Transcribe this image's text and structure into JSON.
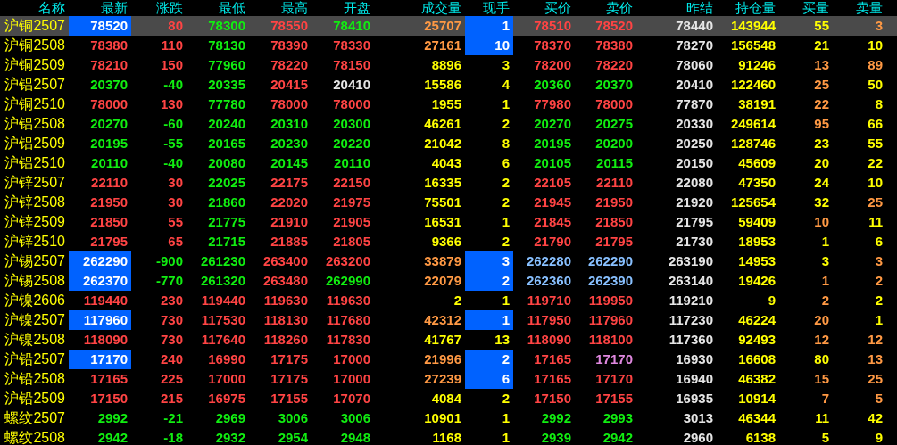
{
  "table": {
    "name_column": "名称",
    "columns": [
      "最新",
      "涨跌",
      "最低",
      "最高",
      "开盘",
      "成交量",
      "现手",
      "买价",
      "卖价",
      "昨结",
      "持仓量",
      "买量",
      "卖量"
    ],
    "rows": [
      {
        "name": "沪铜2507",
        "selected": true,
        "cells": [
          {
            "text": "78520",
            "color": "#ffffff",
            "highlighted": true
          },
          {
            "text": "80",
            "color": "#ff4444",
            "highlighted": false
          },
          {
            "text": "78300",
            "color": "#11ee11",
            "highlighted": false
          },
          {
            "text": "78550",
            "color": "#ff4444",
            "highlighted": false
          },
          {
            "text": "78410",
            "color": "#11ee11",
            "highlighted": false
          },
          {
            "text": "25707",
            "color": "#ff9944",
            "highlighted": false
          },
          {
            "text": "1",
            "color": "#ffffff",
            "highlighted": true
          },
          {
            "text": "78510",
            "color": "#ff4444",
            "highlighted": false
          },
          {
            "text": "78520",
            "color": "#ff4444",
            "highlighted": false
          },
          {
            "text": "78440",
            "color": "#e6e6e6",
            "highlighted": false
          },
          {
            "text": "143944",
            "color": "#ffff00",
            "highlighted": false
          },
          {
            "text": "55",
            "color": "#ffff00",
            "highlighted": false
          },
          {
            "text": "3",
            "color": "#ff9944",
            "highlighted": false
          }
        ]
      },
      {
        "name": "沪铜2508",
        "selected": false,
        "cells": [
          {
            "text": "78380",
            "color": "#ff4444",
            "highlighted": false
          },
          {
            "text": "110",
            "color": "#ff4444",
            "highlighted": false
          },
          {
            "text": "78130",
            "color": "#11ee11",
            "highlighted": false
          },
          {
            "text": "78390",
            "color": "#ff4444",
            "highlighted": false
          },
          {
            "text": "78330",
            "color": "#ff4444",
            "highlighted": false
          },
          {
            "text": "27161",
            "color": "#ff9944",
            "highlighted": false
          },
          {
            "text": "10",
            "color": "#ffffff",
            "highlighted": true
          },
          {
            "text": "78370",
            "color": "#ff4444",
            "highlighted": false
          },
          {
            "text": "78380",
            "color": "#ff4444",
            "highlighted": false
          },
          {
            "text": "78270",
            "color": "#e6e6e6",
            "highlighted": false
          },
          {
            "text": "156548",
            "color": "#ffff00",
            "highlighted": false
          },
          {
            "text": "21",
            "color": "#ffff00",
            "highlighted": false
          },
          {
            "text": "10",
            "color": "#ffff00",
            "highlighted": false
          }
        ]
      },
      {
        "name": "沪铜2509",
        "selected": false,
        "cells": [
          {
            "text": "78210",
            "color": "#ff4444",
            "highlighted": false
          },
          {
            "text": "150",
            "color": "#ff4444",
            "highlighted": false
          },
          {
            "text": "77960",
            "color": "#11ee11",
            "highlighted": false
          },
          {
            "text": "78220",
            "color": "#ff4444",
            "highlighted": false
          },
          {
            "text": "78150",
            "color": "#ff4444",
            "highlighted": false
          },
          {
            "text": "8896",
            "color": "#ffff00",
            "highlighted": false
          },
          {
            "text": "3",
            "color": "#ffff00",
            "highlighted": false
          },
          {
            "text": "78200",
            "color": "#ff4444",
            "highlighted": false
          },
          {
            "text": "78220",
            "color": "#ff4444",
            "highlighted": false
          },
          {
            "text": "78060",
            "color": "#e6e6e6",
            "highlighted": false
          },
          {
            "text": "91246",
            "color": "#ffff00",
            "highlighted": false
          },
          {
            "text": "13",
            "color": "#ff9944",
            "highlighted": false
          },
          {
            "text": "89",
            "color": "#ff9944",
            "highlighted": false
          }
        ]
      },
      {
        "name": "沪铝2507",
        "selected": false,
        "cells": [
          {
            "text": "20370",
            "color": "#11ee11",
            "highlighted": false
          },
          {
            "text": "-40",
            "color": "#11ee11",
            "highlighted": false
          },
          {
            "text": "20335",
            "color": "#11ee11",
            "highlighted": false
          },
          {
            "text": "20415",
            "color": "#ff4444",
            "highlighted": false
          },
          {
            "text": "20410",
            "color": "#e6e6e6",
            "highlighted": false
          },
          {
            "text": "15586",
            "color": "#ffff00",
            "highlighted": false
          },
          {
            "text": "4",
            "color": "#ffff00",
            "highlighted": false
          },
          {
            "text": "20360",
            "color": "#11ee11",
            "highlighted": false
          },
          {
            "text": "20370",
            "color": "#11ee11",
            "highlighted": false
          },
          {
            "text": "20410",
            "color": "#e6e6e6",
            "highlighted": false
          },
          {
            "text": "122460",
            "color": "#ffff00",
            "highlighted": false
          },
          {
            "text": "25",
            "color": "#ff9944",
            "highlighted": false
          },
          {
            "text": "50",
            "color": "#ffff00",
            "highlighted": false
          }
        ]
      },
      {
        "name": "沪铜2510",
        "selected": false,
        "cells": [
          {
            "text": "78000",
            "color": "#ff4444",
            "highlighted": false
          },
          {
            "text": "130",
            "color": "#ff4444",
            "highlighted": false
          },
          {
            "text": "77780",
            "color": "#11ee11",
            "highlighted": false
          },
          {
            "text": "78000",
            "color": "#ff4444",
            "highlighted": false
          },
          {
            "text": "78000",
            "color": "#ff4444",
            "highlighted": false
          },
          {
            "text": "1955",
            "color": "#ffff00",
            "highlighted": false
          },
          {
            "text": "1",
            "color": "#ffff00",
            "highlighted": false
          },
          {
            "text": "77980",
            "color": "#ff4444",
            "highlighted": false
          },
          {
            "text": "78000",
            "color": "#ff4444",
            "highlighted": false
          },
          {
            "text": "77870",
            "color": "#e6e6e6",
            "highlighted": false
          },
          {
            "text": "38191",
            "color": "#ffff00",
            "highlighted": false
          },
          {
            "text": "22",
            "color": "#ff9944",
            "highlighted": false
          },
          {
            "text": "8",
            "color": "#ffff00",
            "highlighted": false
          }
        ]
      },
      {
        "name": "沪铝2508",
        "selected": false,
        "cells": [
          {
            "text": "20270",
            "color": "#11ee11",
            "highlighted": false
          },
          {
            "text": "-60",
            "color": "#11ee11",
            "highlighted": false
          },
          {
            "text": "20240",
            "color": "#11ee11",
            "highlighted": false
          },
          {
            "text": "20310",
            "color": "#11ee11",
            "highlighted": false
          },
          {
            "text": "20300",
            "color": "#11ee11",
            "highlighted": false
          },
          {
            "text": "46261",
            "color": "#ffff00",
            "highlighted": false
          },
          {
            "text": "2",
            "color": "#ffff00",
            "highlighted": false
          },
          {
            "text": "20270",
            "color": "#11ee11",
            "highlighted": false
          },
          {
            "text": "20275",
            "color": "#11ee11",
            "highlighted": false
          },
          {
            "text": "20330",
            "color": "#e6e6e6",
            "highlighted": false
          },
          {
            "text": "249614",
            "color": "#ffff00",
            "highlighted": false
          },
          {
            "text": "95",
            "color": "#ff9944",
            "highlighted": false
          },
          {
            "text": "66",
            "color": "#ffff00",
            "highlighted": false
          }
        ]
      },
      {
        "name": "沪铝2509",
        "selected": false,
        "cells": [
          {
            "text": "20195",
            "color": "#11ee11",
            "highlighted": false
          },
          {
            "text": "-55",
            "color": "#11ee11",
            "highlighted": false
          },
          {
            "text": "20165",
            "color": "#11ee11",
            "highlighted": false
          },
          {
            "text": "20230",
            "color": "#11ee11",
            "highlighted": false
          },
          {
            "text": "20220",
            "color": "#11ee11",
            "highlighted": false
          },
          {
            "text": "21042",
            "color": "#ffff00",
            "highlighted": false
          },
          {
            "text": "8",
            "color": "#ffff00",
            "highlighted": false
          },
          {
            "text": "20195",
            "color": "#11ee11",
            "highlighted": false
          },
          {
            "text": "20200",
            "color": "#11ee11",
            "highlighted": false
          },
          {
            "text": "20250",
            "color": "#e6e6e6",
            "highlighted": false
          },
          {
            "text": "128746",
            "color": "#ffff00",
            "highlighted": false
          },
          {
            "text": "23",
            "color": "#ffff00",
            "highlighted": false
          },
          {
            "text": "55",
            "color": "#ffff00",
            "highlighted": false
          }
        ]
      },
      {
        "name": "沪铝2510",
        "selected": false,
        "cells": [
          {
            "text": "20110",
            "color": "#11ee11",
            "highlighted": false
          },
          {
            "text": "-40",
            "color": "#11ee11",
            "highlighted": false
          },
          {
            "text": "20080",
            "color": "#11ee11",
            "highlighted": false
          },
          {
            "text": "20145",
            "color": "#11ee11",
            "highlighted": false
          },
          {
            "text": "20110",
            "color": "#11ee11",
            "highlighted": false
          },
          {
            "text": "4043",
            "color": "#ffff00",
            "highlighted": false
          },
          {
            "text": "6",
            "color": "#ffff00",
            "highlighted": false
          },
          {
            "text": "20105",
            "color": "#11ee11",
            "highlighted": false
          },
          {
            "text": "20115",
            "color": "#11ee11",
            "highlighted": false
          },
          {
            "text": "20150",
            "color": "#e6e6e6",
            "highlighted": false
          },
          {
            "text": "45609",
            "color": "#ffff00",
            "highlighted": false
          },
          {
            "text": "20",
            "color": "#ffff00",
            "highlighted": false
          },
          {
            "text": "22",
            "color": "#ffff00",
            "highlighted": false
          }
        ]
      },
      {
        "name": "沪锌2507",
        "selected": false,
        "cells": [
          {
            "text": "22110",
            "color": "#ff4444",
            "highlighted": false
          },
          {
            "text": "30",
            "color": "#ff4444",
            "highlighted": false
          },
          {
            "text": "22025",
            "color": "#11ee11",
            "highlighted": false
          },
          {
            "text": "22175",
            "color": "#ff4444",
            "highlighted": false
          },
          {
            "text": "22150",
            "color": "#ff4444",
            "highlighted": false
          },
          {
            "text": "16335",
            "color": "#ffff00",
            "highlighted": false
          },
          {
            "text": "2",
            "color": "#ffff00",
            "highlighted": false
          },
          {
            "text": "22105",
            "color": "#ff4444",
            "highlighted": false
          },
          {
            "text": "22110",
            "color": "#ff4444",
            "highlighted": false
          },
          {
            "text": "22080",
            "color": "#e6e6e6",
            "highlighted": false
          },
          {
            "text": "47350",
            "color": "#ffff00",
            "highlighted": false
          },
          {
            "text": "24",
            "color": "#ffff00",
            "highlighted": false
          },
          {
            "text": "10",
            "color": "#ffff00",
            "highlighted": false
          }
        ]
      },
      {
        "name": "沪锌2508",
        "selected": false,
        "cells": [
          {
            "text": "21950",
            "color": "#ff4444",
            "highlighted": false
          },
          {
            "text": "30",
            "color": "#ff4444",
            "highlighted": false
          },
          {
            "text": "21860",
            "color": "#11ee11",
            "highlighted": false
          },
          {
            "text": "22020",
            "color": "#ff4444",
            "highlighted": false
          },
          {
            "text": "21975",
            "color": "#ff4444",
            "highlighted": false
          },
          {
            "text": "75501",
            "color": "#ffff00",
            "highlighted": false
          },
          {
            "text": "2",
            "color": "#ffff00",
            "highlighted": false
          },
          {
            "text": "21945",
            "color": "#ff4444",
            "highlighted": false
          },
          {
            "text": "21950",
            "color": "#ff4444",
            "highlighted": false
          },
          {
            "text": "21920",
            "color": "#e6e6e6",
            "highlighted": false
          },
          {
            "text": "125654",
            "color": "#ffff00",
            "highlighted": false
          },
          {
            "text": "32",
            "color": "#ffff00",
            "highlighted": false
          },
          {
            "text": "25",
            "color": "#ff9944",
            "highlighted": false
          }
        ]
      },
      {
        "name": "沪锌2509",
        "selected": false,
        "cells": [
          {
            "text": "21850",
            "color": "#ff4444",
            "highlighted": false
          },
          {
            "text": "55",
            "color": "#ff4444",
            "highlighted": false
          },
          {
            "text": "21775",
            "color": "#11ee11",
            "highlighted": false
          },
          {
            "text": "21910",
            "color": "#ff4444",
            "highlighted": false
          },
          {
            "text": "21905",
            "color": "#ff4444",
            "highlighted": false
          },
          {
            "text": "16531",
            "color": "#ffff00",
            "highlighted": false
          },
          {
            "text": "1",
            "color": "#ffff00",
            "highlighted": false
          },
          {
            "text": "21845",
            "color": "#ff4444",
            "highlighted": false
          },
          {
            "text": "21850",
            "color": "#ff4444",
            "highlighted": false
          },
          {
            "text": "21795",
            "color": "#e6e6e6",
            "highlighted": false
          },
          {
            "text": "59409",
            "color": "#ffff00",
            "highlighted": false
          },
          {
            "text": "10",
            "color": "#ff9944",
            "highlighted": false
          },
          {
            "text": "11",
            "color": "#ffff00",
            "highlighted": false
          }
        ]
      },
      {
        "name": "沪锌2510",
        "selected": false,
        "cells": [
          {
            "text": "21795",
            "color": "#ff4444",
            "highlighted": false
          },
          {
            "text": "65",
            "color": "#ff4444",
            "highlighted": false
          },
          {
            "text": "21715",
            "color": "#11ee11",
            "highlighted": false
          },
          {
            "text": "21885",
            "color": "#ff4444",
            "highlighted": false
          },
          {
            "text": "21805",
            "color": "#ff4444",
            "highlighted": false
          },
          {
            "text": "9366",
            "color": "#ffff00",
            "highlighted": false
          },
          {
            "text": "2",
            "color": "#ffff00",
            "highlighted": false
          },
          {
            "text": "21790",
            "color": "#ff4444",
            "highlighted": false
          },
          {
            "text": "21795",
            "color": "#ff4444",
            "highlighted": false
          },
          {
            "text": "21730",
            "color": "#e6e6e6",
            "highlighted": false
          },
          {
            "text": "18953",
            "color": "#ffff00",
            "highlighted": false
          },
          {
            "text": "1",
            "color": "#ffff00",
            "highlighted": false
          },
          {
            "text": "6",
            "color": "#ffff00",
            "highlighted": false
          }
        ]
      },
      {
        "name": "沪锡2507",
        "selected": false,
        "cells": [
          {
            "text": "262290",
            "color": "#ffffff",
            "highlighted": true
          },
          {
            "text": "-900",
            "color": "#11ee11",
            "highlighted": false
          },
          {
            "text": "261230",
            "color": "#11ee11",
            "highlighted": false
          },
          {
            "text": "263400",
            "color": "#ff4444",
            "highlighted": false
          },
          {
            "text": "263200",
            "color": "#ff4444",
            "highlighted": false
          },
          {
            "text": "33879",
            "color": "#ff9944",
            "highlighted": false
          },
          {
            "text": "3",
            "color": "#ffffff",
            "highlighted": true
          },
          {
            "text": "262280",
            "color": "#88c0ff",
            "highlighted": false
          },
          {
            "text": "262290",
            "color": "#88c0ff",
            "highlighted": false
          },
          {
            "text": "263190",
            "color": "#e6e6e6",
            "highlighted": false
          },
          {
            "text": "14953",
            "color": "#ffff00",
            "highlighted": false
          },
          {
            "text": "3",
            "color": "#ffff00",
            "highlighted": false
          },
          {
            "text": "3",
            "color": "#ff9944",
            "highlighted": false
          }
        ]
      },
      {
        "name": "沪锡2508",
        "selected": false,
        "cells": [
          {
            "text": "262370",
            "color": "#ffffff",
            "highlighted": true
          },
          {
            "text": "-770",
            "color": "#11ee11",
            "highlighted": false
          },
          {
            "text": "261320",
            "color": "#11ee11",
            "highlighted": false
          },
          {
            "text": "263480",
            "color": "#ff4444",
            "highlighted": false
          },
          {
            "text": "262990",
            "color": "#11ee11",
            "highlighted": false
          },
          {
            "text": "22079",
            "color": "#ff9944",
            "highlighted": false
          },
          {
            "text": "2",
            "color": "#ffffff",
            "highlighted": true
          },
          {
            "text": "262360",
            "color": "#88c0ff",
            "highlighted": false
          },
          {
            "text": "262390",
            "color": "#88c0ff",
            "highlighted": false
          },
          {
            "text": "263140",
            "color": "#e6e6e6",
            "highlighted": false
          },
          {
            "text": "19426",
            "color": "#ffff00",
            "highlighted": false
          },
          {
            "text": "1",
            "color": "#ff9944",
            "highlighted": false
          },
          {
            "text": "2",
            "color": "#ff9944",
            "highlighted": false
          }
        ]
      },
      {
        "name": "沪镍2606",
        "selected": false,
        "cells": [
          {
            "text": "119440",
            "color": "#ff4444",
            "highlighted": false
          },
          {
            "text": "230",
            "color": "#ff4444",
            "highlighted": false
          },
          {
            "text": "119440",
            "color": "#ff4444",
            "highlighted": false
          },
          {
            "text": "119630",
            "color": "#ff4444",
            "highlighted": false
          },
          {
            "text": "119630",
            "color": "#ff4444",
            "highlighted": false
          },
          {
            "text": "2",
            "color": "#ffff00",
            "highlighted": false
          },
          {
            "text": "1",
            "color": "#ffff00",
            "highlighted": false
          },
          {
            "text": "119710",
            "color": "#ff4444",
            "highlighted": false
          },
          {
            "text": "119950",
            "color": "#ff4444",
            "highlighted": false
          },
          {
            "text": "119210",
            "color": "#e6e6e6",
            "highlighted": false
          },
          {
            "text": "9",
            "color": "#ffff00",
            "highlighted": false
          },
          {
            "text": "2",
            "color": "#ff9944",
            "highlighted": false
          },
          {
            "text": "2",
            "color": "#ffff00",
            "highlighted": false
          }
        ]
      },
      {
        "name": "沪镍2507",
        "selected": false,
        "cells": [
          {
            "text": "117960",
            "color": "#ffffff",
            "highlighted": true
          },
          {
            "text": "730",
            "color": "#ff4444",
            "highlighted": false
          },
          {
            "text": "117530",
            "color": "#ff4444",
            "highlighted": false
          },
          {
            "text": "118130",
            "color": "#ff4444",
            "highlighted": false
          },
          {
            "text": "117680",
            "color": "#ff4444",
            "highlighted": false
          },
          {
            "text": "42312",
            "color": "#ff9944",
            "highlighted": false
          },
          {
            "text": "1",
            "color": "#ffffff",
            "highlighted": true
          },
          {
            "text": "117950",
            "color": "#ff4444",
            "highlighted": false
          },
          {
            "text": "117960",
            "color": "#ff4444",
            "highlighted": false
          },
          {
            "text": "117230",
            "color": "#e6e6e6",
            "highlighted": false
          },
          {
            "text": "46224",
            "color": "#ffff00",
            "highlighted": false
          },
          {
            "text": "20",
            "color": "#ff9944",
            "highlighted": false
          },
          {
            "text": "1",
            "color": "#ffff00",
            "highlighted": false
          }
        ]
      },
      {
        "name": "沪镍2508",
        "selected": false,
        "cells": [
          {
            "text": "118090",
            "color": "#ff4444",
            "highlighted": false
          },
          {
            "text": "730",
            "color": "#ff4444",
            "highlighted": false
          },
          {
            "text": "117640",
            "color": "#ff4444",
            "highlighted": false
          },
          {
            "text": "118260",
            "color": "#ff4444",
            "highlighted": false
          },
          {
            "text": "117830",
            "color": "#ff4444",
            "highlighted": false
          },
          {
            "text": "41767",
            "color": "#ffff00",
            "highlighted": false
          },
          {
            "text": "13",
            "color": "#ffff00",
            "highlighted": false
          },
          {
            "text": "118090",
            "color": "#ff4444",
            "highlighted": false
          },
          {
            "text": "118100",
            "color": "#ff4444",
            "highlighted": false
          },
          {
            "text": "117360",
            "color": "#e6e6e6",
            "highlighted": false
          },
          {
            "text": "92493",
            "color": "#ffff00",
            "highlighted": false
          },
          {
            "text": "12",
            "color": "#ff9944",
            "highlighted": false
          },
          {
            "text": "12",
            "color": "#ff9944",
            "highlighted": false
          }
        ]
      },
      {
        "name": "沪铅2507",
        "selected": false,
        "cells": [
          {
            "text": "17170",
            "color": "#ffffff",
            "highlighted": true
          },
          {
            "text": "240",
            "color": "#ff4444",
            "highlighted": false
          },
          {
            "text": "16990",
            "color": "#ff4444",
            "highlighted": false
          },
          {
            "text": "17175",
            "color": "#ff4444",
            "highlighted": false
          },
          {
            "text": "17000",
            "color": "#ff4444",
            "highlighted": false
          },
          {
            "text": "21996",
            "color": "#ff9944",
            "highlighted": false
          },
          {
            "text": "2",
            "color": "#ffffff",
            "highlighted": true
          },
          {
            "text": "17165",
            "color": "#ff4444",
            "highlighted": false
          },
          {
            "text": "17170",
            "color": "#e088e0",
            "highlighted": false
          },
          {
            "text": "16930",
            "color": "#e6e6e6",
            "highlighted": false
          },
          {
            "text": "16608",
            "color": "#ffff00",
            "highlighted": false
          },
          {
            "text": "80",
            "color": "#ffff00",
            "highlighted": false
          },
          {
            "text": "13",
            "color": "#ff9944",
            "highlighted": false
          }
        ]
      },
      {
        "name": "沪铅2508",
        "selected": false,
        "cells": [
          {
            "text": "17165",
            "color": "#ff4444",
            "highlighted": false
          },
          {
            "text": "225",
            "color": "#ff4444",
            "highlighted": false
          },
          {
            "text": "17000",
            "color": "#ff4444",
            "highlighted": false
          },
          {
            "text": "17175",
            "color": "#ff4444",
            "highlighted": false
          },
          {
            "text": "17000",
            "color": "#ff4444",
            "highlighted": false
          },
          {
            "text": "27239",
            "color": "#ff9944",
            "highlighted": false
          },
          {
            "text": "6",
            "color": "#ffffff",
            "highlighted": true
          },
          {
            "text": "17165",
            "color": "#ff4444",
            "highlighted": false
          },
          {
            "text": "17170",
            "color": "#ff4444",
            "highlighted": false
          },
          {
            "text": "16940",
            "color": "#e6e6e6",
            "highlighted": false
          },
          {
            "text": "46382",
            "color": "#ffff00",
            "highlighted": false
          },
          {
            "text": "15",
            "color": "#ff9944",
            "highlighted": false
          },
          {
            "text": "25",
            "color": "#ff9944",
            "highlighted": false
          }
        ]
      },
      {
        "name": "沪铅2509",
        "selected": false,
        "cells": [
          {
            "text": "17150",
            "color": "#ff4444",
            "highlighted": false
          },
          {
            "text": "215",
            "color": "#ff4444",
            "highlighted": false
          },
          {
            "text": "16975",
            "color": "#ff4444",
            "highlighted": false
          },
          {
            "text": "17155",
            "color": "#ff4444",
            "highlighted": false
          },
          {
            "text": "17070",
            "color": "#ff4444",
            "highlighted": false
          },
          {
            "text": "4084",
            "color": "#ffff00",
            "highlighted": false
          },
          {
            "text": "2",
            "color": "#ffff00",
            "highlighted": false
          },
          {
            "text": "17150",
            "color": "#ff4444",
            "highlighted": false
          },
          {
            "text": "17155",
            "color": "#ff4444",
            "highlighted": false
          },
          {
            "text": "16935",
            "color": "#e6e6e6",
            "highlighted": false
          },
          {
            "text": "10914",
            "color": "#ffff00",
            "highlighted": false
          },
          {
            "text": "7",
            "color": "#ff9944",
            "highlighted": false
          },
          {
            "text": "5",
            "color": "#ff9944",
            "highlighted": false
          }
        ]
      },
      {
        "name": "螺纹2507",
        "selected": false,
        "cells": [
          {
            "text": "2992",
            "color": "#11ee11",
            "highlighted": false
          },
          {
            "text": "-21",
            "color": "#11ee11",
            "highlighted": false
          },
          {
            "text": "2969",
            "color": "#11ee11",
            "highlighted": false
          },
          {
            "text": "3006",
            "color": "#11ee11",
            "highlighted": false
          },
          {
            "text": "3006",
            "color": "#11ee11",
            "highlighted": false
          },
          {
            "text": "10901",
            "color": "#ffff00",
            "highlighted": false
          },
          {
            "text": "1",
            "color": "#ffff00",
            "highlighted": false
          },
          {
            "text": "2992",
            "color": "#11ee11",
            "highlighted": false
          },
          {
            "text": "2993",
            "color": "#11ee11",
            "highlighted": false
          },
          {
            "text": "3013",
            "color": "#e6e6e6",
            "highlighted": false
          },
          {
            "text": "46344",
            "color": "#ffff00",
            "highlighted": false
          },
          {
            "text": "11",
            "color": "#ffff00",
            "highlighted": false
          },
          {
            "text": "42",
            "color": "#ffff00",
            "highlighted": false
          }
        ]
      },
      {
        "name": "螺纹2508",
        "selected": false,
        "cells": [
          {
            "text": "2942",
            "color": "#11ee11",
            "highlighted": false
          },
          {
            "text": "-18",
            "color": "#11ee11",
            "highlighted": false
          },
          {
            "text": "2932",
            "color": "#11ee11",
            "highlighted": false
          },
          {
            "text": "2954",
            "color": "#11ee11",
            "highlighted": false
          },
          {
            "text": "2948",
            "color": "#11ee11",
            "highlighted": false
          },
          {
            "text": "1168",
            "color": "#ffff00",
            "highlighted": false
          },
          {
            "text": "1",
            "color": "#ffff00",
            "highlighted": false
          },
          {
            "text": "2939",
            "color": "#11ee11",
            "highlighted": false
          },
          {
            "text": "2942",
            "color": "#11ee11",
            "highlighted": false
          },
          {
            "text": "2960",
            "color": "#e6e6e6",
            "highlighted": false
          },
          {
            "text": "6138",
            "color": "#ffff00",
            "highlighted": false
          },
          {
            "text": "5",
            "color": "#ffff00",
            "highlighted": false
          },
          {
            "text": "9",
            "color": "#ffff00",
            "highlighted": false
          }
        ]
      }
    ]
  }
}
